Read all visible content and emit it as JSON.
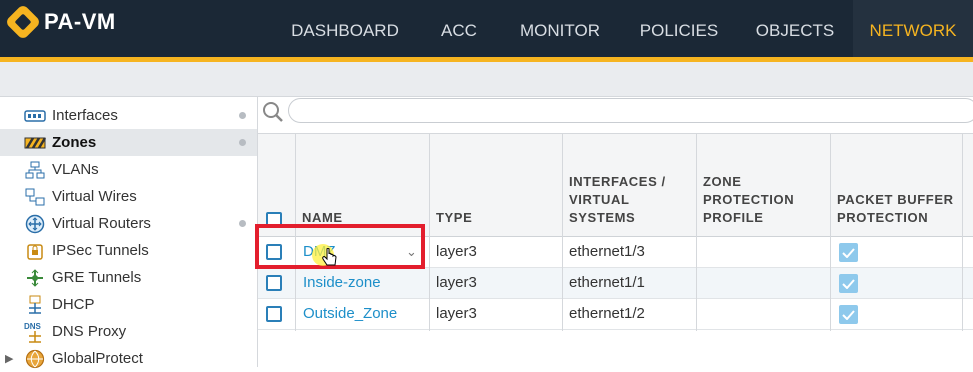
{
  "app": {
    "name": "PA-VM"
  },
  "nav": {
    "tabs": [
      {
        "label": "DASHBOARD",
        "active": false
      },
      {
        "label": "ACC",
        "active": false
      },
      {
        "label": "MONITOR",
        "active": false
      },
      {
        "label": "POLICIES",
        "active": false
      },
      {
        "label": "OBJECTS",
        "active": false
      },
      {
        "label": "NETWORK",
        "active": true
      }
    ]
  },
  "sidebar": {
    "items": [
      {
        "label": "Interfaces",
        "icon": "interfaces-icon",
        "active": false
      },
      {
        "label": "Zones",
        "icon": "zones-icon",
        "active": true
      },
      {
        "label": "VLANs",
        "icon": "vlans-icon",
        "active": false
      },
      {
        "label": "Virtual Wires",
        "icon": "virtual-wires-icon",
        "active": false
      },
      {
        "label": "Virtual Routers",
        "icon": "virtual-routers-icon",
        "active": false
      },
      {
        "label": "IPSec Tunnels",
        "icon": "ipsec-tunnels-icon",
        "active": false
      },
      {
        "label": "GRE Tunnels",
        "icon": "gre-tunnels-icon",
        "active": false
      },
      {
        "label": "DHCP",
        "icon": "dhcp-icon",
        "active": false
      },
      {
        "label": "DNS Proxy",
        "icon": "dns-proxy-icon",
        "active": false
      },
      {
        "label": "GlobalProtect",
        "icon": "globalprotect-icon",
        "active": false
      }
    ]
  },
  "search": {
    "placeholder": ""
  },
  "table": {
    "columns": [
      {
        "label": "NAME"
      },
      {
        "label": "TYPE"
      },
      {
        "label": "INTERFACES /\nVIRTUAL\nSYSTEMS"
      },
      {
        "label": "ZONE\nPROTECTION\nPROFILE"
      },
      {
        "label": "PACKET BUFFER\nPROTECTION"
      }
    ],
    "rows": [
      {
        "name": "DMZ",
        "type": "layer3",
        "interfaces": "ethernet1/3",
        "zone_protection_profile": "",
        "packet_buffer_protection": true
      },
      {
        "name": "Inside-zone",
        "type": "layer3",
        "interfaces": "ethernet1/1",
        "zone_protection_profile": "",
        "packet_buffer_protection": true
      },
      {
        "name": "Outside_Zone",
        "type": "layer3",
        "interfaces": "ethernet1/2",
        "zone_protection_profile": "",
        "packet_buffer_protection": true
      }
    ]
  },
  "colors": {
    "brand_yellow": "#f6b420",
    "header_dark": "#1b2836",
    "link_blue": "#1d8fc9",
    "highlight_red": "#e31e2d"
  }
}
